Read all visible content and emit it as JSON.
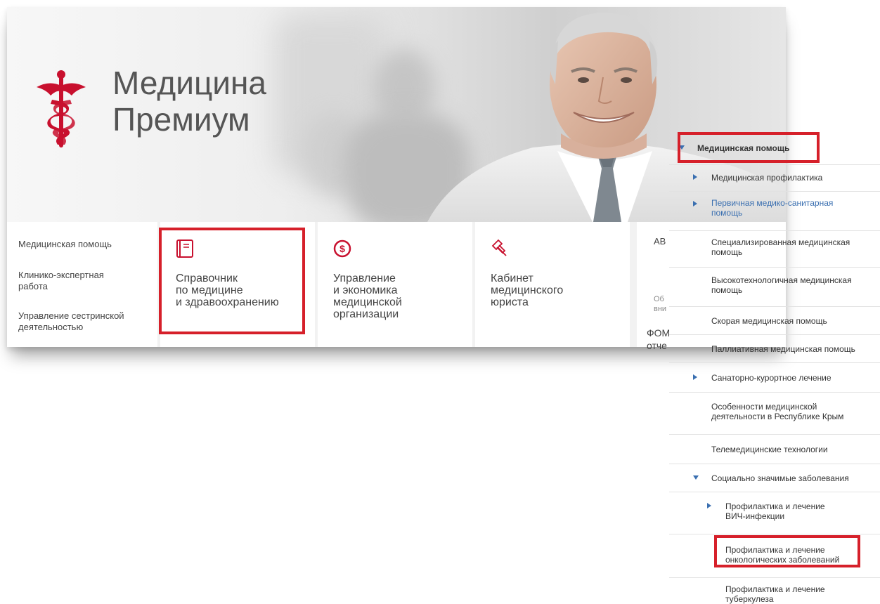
{
  "brand": {
    "line1": "Медицина",
    "line2": "Премиум"
  },
  "left_menu": [
    "Медицинская помощь",
    "Клинико-экспертная работа",
    "Управление сестринской деятельностью"
  ],
  "tiles": [
    {
      "icon": "book-icon",
      "label": "Справочник\nпо медицине\nи здравоохранению",
      "highlighted": true
    },
    {
      "icon": "dollar-circle-icon",
      "label": "Управление\nи экономика\nмедицинской\nорганизации",
      "highlighted": false
    },
    {
      "icon": "gavel-icon",
      "label": "Кабинет\nмедицинского\nюриста",
      "highlighted": false
    }
  ],
  "right_stub": {
    "t1": "АВ",
    "t2": "Об",
    "t3": "вни",
    "t4": "ФОМ",
    "t5": "отче"
  },
  "sidebar": {
    "items": [
      {
        "label": "Медицинская помощь",
        "arrow": "down",
        "bold": true,
        "highlighted": true
      },
      {
        "label": "Медицинская профилактика",
        "arrow": "right"
      },
      {
        "label": "Первичная медико-санитарная помощь",
        "arrow": "right",
        "link": true
      },
      {
        "label": "Специализированная медицинская помощь",
        "arrow": "none"
      },
      {
        "label": "Высокотехнологичная медицинская помощь",
        "arrow": "none"
      },
      {
        "label": "Скорая медицинская помощь",
        "arrow": "none"
      },
      {
        "label": "Паллиативная медицинская помощь",
        "arrow": "none"
      },
      {
        "label": "Санаторно-курортное лечение",
        "arrow": "right"
      },
      {
        "label": "Особенности медицинской деятельности в Республике Крым",
        "arrow": "none"
      },
      {
        "label": "Телемедицинские технологии",
        "arrow": "none"
      },
      {
        "label": "Социально значимые заболевания",
        "arrow": "down"
      },
      {
        "label": "Профилактика и лечение ВИЧ-инфекции",
        "arrow": "right"
      },
      {
        "label": "Профилактика и лечение онкологических заболеваний",
        "arrow": "none",
        "highlighted": true
      },
      {
        "label": "Профилактика и лечение туберкулеза",
        "arrow": "none"
      }
    ]
  },
  "colors": {
    "highlight": "#d6202a",
    "logo_red": "#c8102e",
    "link_blue": "#3a6fb0"
  }
}
